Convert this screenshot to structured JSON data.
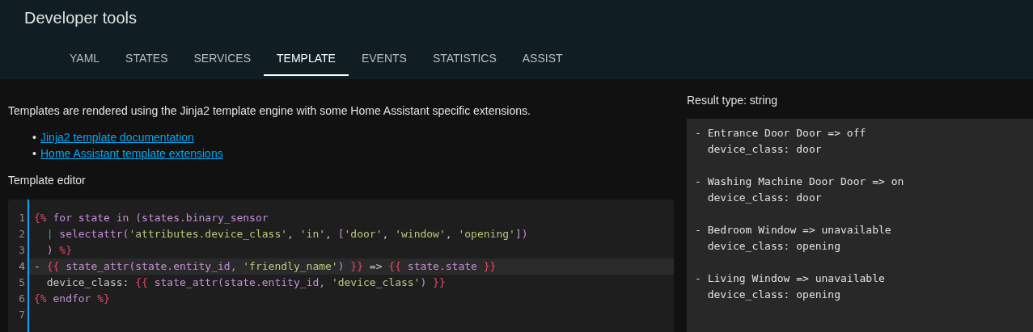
{
  "header": {
    "title": "Developer tools"
  },
  "tabs": [
    {
      "label": "YAML",
      "selected": false
    },
    {
      "label": "STATES",
      "selected": false
    },
    {
      "label": "SERVICES",
      "selected": false
    },
    {
      "label": "TEMPLATE",
      "selected": true
    },
    {
      "label": "EVENTS",
      "selected": false
    },
    {
      "label": "STATISTICS",
      "selected": false
    },
    {
      "label": "ASSIST",
      "selected": false
    }
  ],
  "intro": "Templates are rendered using the Jinja2 template engine with some Home Assistant specific extensions.",
  "links": [
    {
      "marker": "•",
      "text": "Jinja2 template documentation"
    },
    {
      "marker": "•",
      "text": "Home Assistant template extensions"
    }
  ],
  "editor": {
    "label": "Template editor",
    "lines": [
      {
        "number": "1",
        "active": false,
        "tokens": [
          {
            "kind": "delim",
            "text": "{%"
          },
          {
            "kind": "name",
            "text": " for state in (states.binary_sensor"
          }
        ]
      },
      {
        "number": "2",
        "active": false,
        "tokens": [
          {
            "kind": "pipe",
            "text": "  |"
          },
          {
            "kind": "name",
            "text": " selectattr("
          },
          {
            "kind": "string",
            "text": "'attributes.device_class'"
          },
          {
            "kind": "plain",
            "text": ", "
          },
          {
            "kind": "string",
            "text": "'in'"
          },
          {
            "kind": "plain",
            "text": ", "
          },
          {
            "kind": "name",
            "text": "["
          },
          {
            "kind": "string",
            "text": "'door'"
          },
          {
            "kind": "plain",
            "text": ", "
          },
          {
            "kind": "string",
            "text": "'window'"
          },
          {
            "kind": "plain",
            "text": ", "
          },
          {
            "kind": "string",
            "text": "'opening'"
          },
          {
            "kind": "name",
            "text": "])"
          }
        ]
      },
      {
        "number": "3",
        "active": false,
        "tokens": [
          {
            "kind": "name",
            "text": "  ) "
          },
          {
            "kind": "delim",
            "text": "%}"
          }
        ]
      },
      {
        "number": "4",
        "active": true,
        "tokens": [
          {
            "kind": "plain",
            "text": "- "
          },
          {
            "kind": "delim",
            "text": "{{"
          },
          {
            "kind": "name",
            "text": " state_attr(state.entity_id, "
          },
          {
            "kind": "string",
            "text": "'friendly_name'"
          },
          {
            "kind": "name",
            "text": ") "
          },
          {
            "kind": "delim",
            "text": "}}"
          },
          {
            "kind": "plain",
            "text": " => "
          },
          {
            "kind": "delim",
            "text": "{{"
          },
          {
            "kind": "name",
            "text": " state.state "
          },
          {
            "kind": "delim",
            "text": "}}"
          }
        ]
      },
      {
        "number": "5",
        "active": false,
        "tokens": [
          {
            "kind": "plain",
            "text": "  device_class: "
          },
          {
            "kind": "delim",
            "text": "{{"
          },
          {
            "kind": "name",
            "text": " state_attr(state.entity_id, "
          },
          {
            "kind": "string",
            "text": "'device_class'"
          },
          {
            "kind": "name",
            "text": ") "
          },
          {
            "kind": "delim",
            "text": "}}"
          }
        ]
      },
      {
        "number": "6",
        "active": false,
        "tokens": [
          {
            "kind": "delim",
            "text": "{%"
          },
          {
            "kind": "name",
            "text": " endfor "
          },
          {
            "kind": "delim",
            "text": "%}"
          }
        ]
      },
      {
        "number": "7",
        "active": false
      }
    ]
  },
  "result": {
    "type_label": "Result type: string",
    "entries": [
      {
        "lines": [
          "- Entrance Door Door => off",
          "  device_class: door"
        ]
      },
      {
        "lines": [
          "- Washing Machine Door Door => on",
          "  device_class: door"
        ]
      },
      {
        "lines": [
          "- Bedroom Window => unavailable",
          "  device_class: opening"
        ]
      },
      {
        "lines": [
          "- Living Window => unavailable",
          "  device_class: opening"
        ]
      }
    ]
  }
}
